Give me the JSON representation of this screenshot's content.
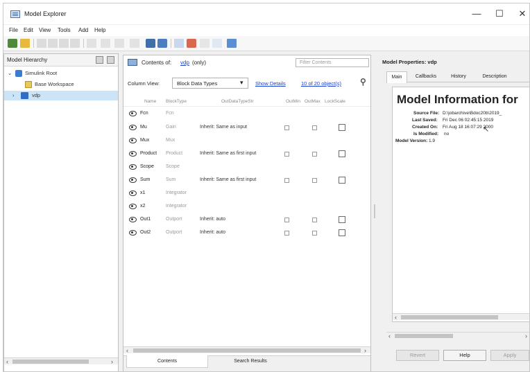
{
  "window": {
    "title": "Model Explorer",
    "controls": {
      "minimize": "—",
      "maximize": "☐",
      "close": "✕"
    }
  },
  "menu": [
    "File",
    "Edit",
    "View",
    "Tools",
    "Add",
    "Help"
  ],
  "hierarchy": {
    "title": "Model Hierarchy",
    "items": [
      {
        "label": "Simulink Root"
      },
      {
        "label": "Base Workspace"
      },
      {
        "label": "vdp"
      }
    ]
  },
  "contents": {
    "title_prefix": "Contents of:",
    "title_link": "vdp",
    "title_suffix": "(only)",
    "filter_placeholder": "Filter Contents",
    "column_view_label": "Column View:",
    "column_view_value": "Block Data Types",
    "show_details": "Show Details",
    "object_count": "10 of 20 object(s)",
    "columns": [
      "Name",
      "BlockType",
      "OutDataTypeStr",
      "OutMin",
      "OutMax",
      "LockScale"
    ],
    "rows": [
      {
        "name": "Fcn",
        "type": "Fcn",
        "out": "",
        "has_minmax": false,
        "has_lock": false
      },
      {
        "name": "Mu",
        "type": "Gain",
        "out": "Inherit: Same as input",
        "has_minmax": true,
        "has_lock": true
      },
      {
        "name": "Mux",
        "type": "Mux",
        "out": "",
        "has_minmax": false,
        "has_lock": false
      },
      {
        "name": "Product",
        "type": "Product",
        "out": "Inherit: Same as first input",
        "has_minmax": true,
        "has_lock": true
      },
      {
        "name": "Scope",
        "type": "Scope",
        "out": "",
        "has_minmax": false,
        "has_lock": false
      },
      {
        "name": "Sum",
        "type": "Sum",
        "out": "Inherit: Same as first input",
        "has_minmax": true,
        "has_lock": true
      },
      {
        "name": "x1",
        "type": "Integrator",
        "out": "",
        "has_minmax": false,
        "has_lock": false
      },
      {
        "name": "x2",
        "type": "Integrator",
        "out": "",
        "has_minmax": false,
        "has_lock": false
      },
      {
        "name": "Out1",
        "type": "Outport",
        "out": "Inherit: auto",
        "has_minmax": true,
        "has_lock": true
      },
      {
        "name": "Out2",
        "type": "Outport",
        "out": "Inherit: auto",
        "has_minmax": true,
        "has_lock": true
      }
    ],
    "tabs": [
      "Contents",
      "Search Results"
    ]
  },
  "properties": {
    "title": "Model Properties: vdp",
    "tabs": [
      "Main",
      "Callbacks",
      "History",
      "Description"
    ],
    "info_title": "Model Information for",
    "source_label": "Source File:",
    "source_value": "D:\\jobarchive\\Bdoc20b\\2019_",
    "saved_label": "Last Saved:",
    "saved_value": "Fri Dec 06 02:45:15 2019",
    "created_label": "Created On:",
    "created_value": "Fri Aug 18 16:07:29 2000",
    "modified_label": "Is Modified:",
    "modified_value": "no",
    "version_label": "Model Version:",
    "version_value": "1.9",
    "buttons": {
      "revert": "Revert",
      "help": "Help",
      "apply": "Apply"
    }
  },
  "colors": {
    "accent": "#1a3fd4",
    "selection": "#cce4f7"
  }
}
